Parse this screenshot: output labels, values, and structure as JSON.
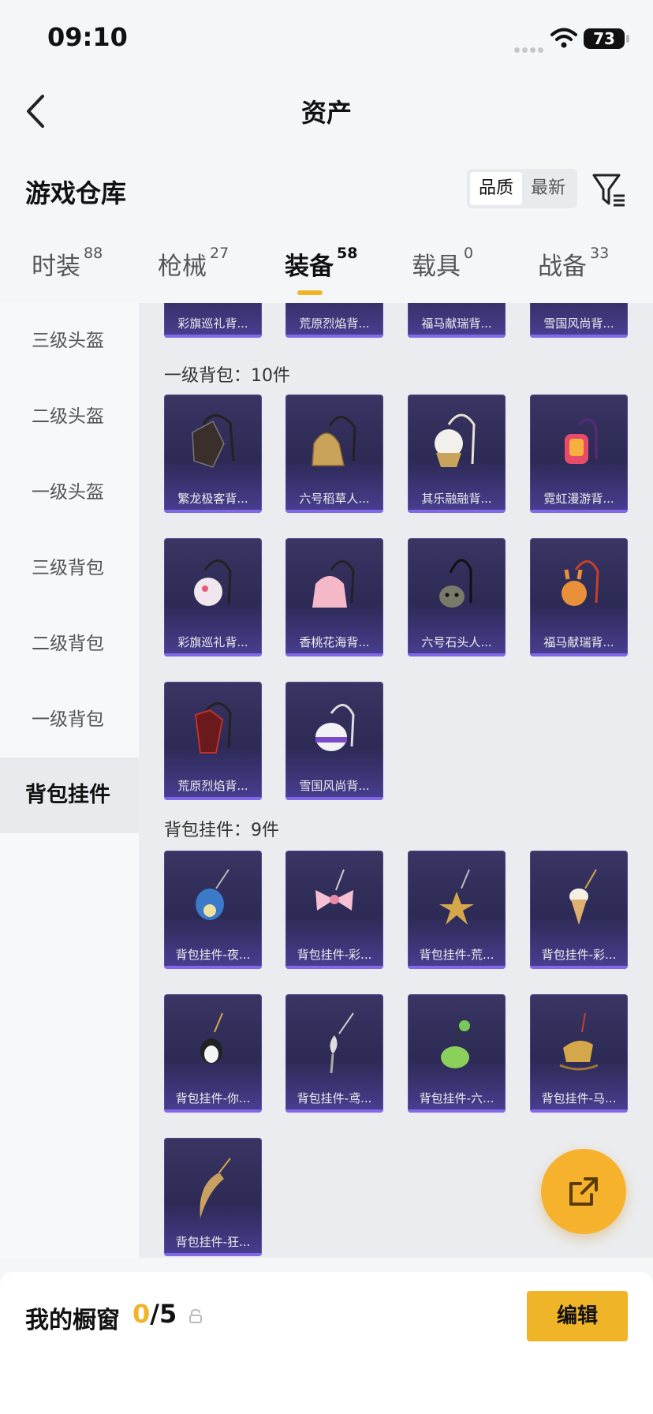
{
  "status_bar": {
    "time": "09:10",
    "battery": "73"
  },
  "header": {
    "title": "资产"
  },
  "warehouse": {
    "title": "游戏仓库",
    "sort_options": [
      "品质",
      "最新"
    ]
  },
  "tabs": [
    {
      "label": "时装",
      "count": "88"
    },
    {
      "label": "枪械",
      "count": "27"
    },
    {
      "label": "装备",
      "count": "58"
    },
    {
      "label": "载具",
      "count": "0"
    },
    {
      "label": "战备",
      "count": "33"
    }
  ],
  "sidebar": {
    "items": [
      "三级头盔",
      "二级头盔",
      "一级头盔",
      "三级背包",
      "二级背包",
      "一级背包",
      "背包挂件"
    ]
  },
  "content": {
    "prev_row": [
      "彩旗巡礼背...",
      "荒原烈焰背...",
      "福马献瑞背...",
      "雪国风尚背..."
    ],
    "groups": [
      {
        "label": "一级背包：10件",
        "items": [
          "繁龙极客背...",
          "六号稻草人...",
          "其乐融融背...",
          "霓虹漫游背...",
          "彩旗巡礼背...",
          "香桃花海背...",
          "六号石头人...",
          "福马献瑞背...",
          "荒原烈焰背...",
          "雪国风尚背..."
        ]
      },
      {
        "label": "背包挂件：9件",
        "items": [
          "背包挂件-夜...",
          "背包挂件-彩...",
          "背包挂件-荒...",
          "背包挂件-彩...",
          "背包挂件-你...",
          "背包挂件-鸢...",
          "背包挂件-六...",
          "背包挂件-马...",
          "背包挂件-狂..."
        ]
      }
    ]
  },
  "bottom": {
    "label": "我的橱窗",
    "current": "0",
    "total": "/5",
    "edit_label": "编辑"
  },
  "colors": {
    "accent": "#f0b429",
    "card_bg": "#2d2a55"
  }
}
